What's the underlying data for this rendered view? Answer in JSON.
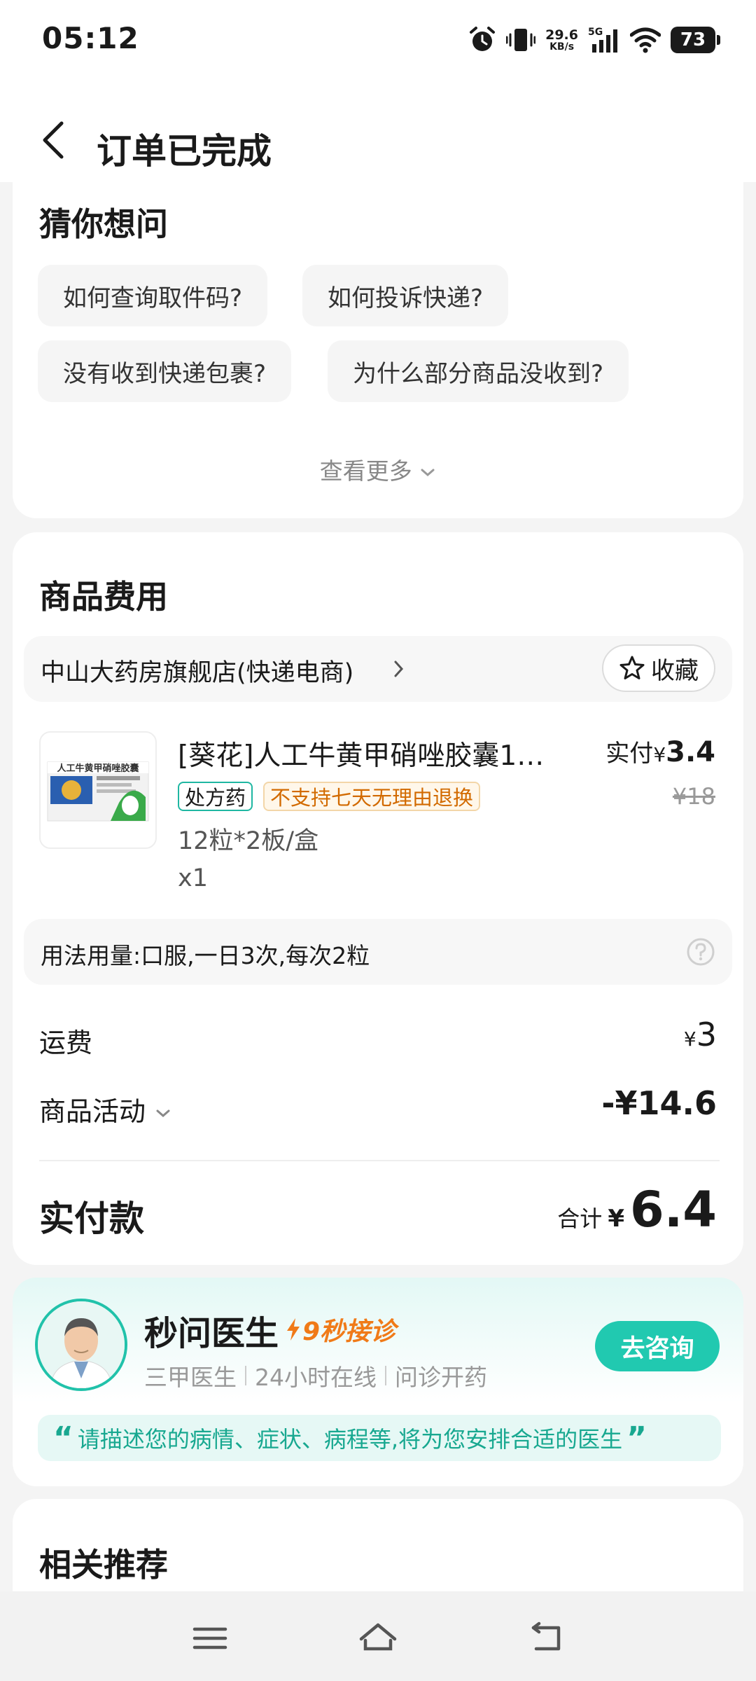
{
  "status_bar": {
    "time": "05:12",
    "net_speed_value": "29.6",
    "net_speed_unit": "KB/s",
    "network": "5G",
    "battery": "73",
    "icons": [
      "alarm-icon",
      "vibrate-icon",
      "signal-icon",
      "wifi-icon",
      "battery-icon"
    ]
  },
  "header": {
    "title": "订单已完成"
  },
  "faq": {
    "title": "猜你想问",
    "chips": [
      "如何查询取件码?",
      "如何投诉快递?",
      "没有收到快递包裹?",
      "为什么部分商品没收到?"
    ],
    "more": "查看更多"
  },
  "cost": {
    "title": "商品费用",
    "store_name": "中山大药房旗舰店(快递电商)",
    "favorite_label": "收藏",
    "product": {
      "name": "[葵花]人工牛黄甲硝唑胶囊1…",
      "image_text": "人工牛黄甲硝唑胶囊",
      "tag_rx": "处方药",
      "tag_no_return": "不支持七天无理由退换",
      "spec": "12粒*2板/盒",
      "qty": "x1",
      "paid_label": "实付",
      "paid_currency": "¥",
      "paid_amount": "3.4",
      "original_price": "¥18"
    },
    "usage": "用法用量:口服,一日3次,每次2粒",
    "shipping_label": "运费",
    "shipping_currency": "¥",
    "shipping_value": "3",
    "promo_label": "商品活动",
    "promo_value": "-¥14.6",
    "total_label": "实付款",
    "total_prefix": "合计",
    "total_currency": "¥",
    "total_value": "6.4"
  },
  "doctor": {
    "name": "秒问医生",
    "fast": "9秒接诊",
    "features": [
      "三甲医生",
      "24小时在线",
      "问诊开药"
    ],
    "button": "去咨询",
    "quote": "请描述您的病情、症状、病程等,将为您安排合适的医生"
  },
  "recommend": {
    "title": "相关推荐"
  },
  "colors": {
    "accent": "#21c9b0",
    "warning": "#d26a00",
    "fast_orange": "#f07a18"
  }
}
